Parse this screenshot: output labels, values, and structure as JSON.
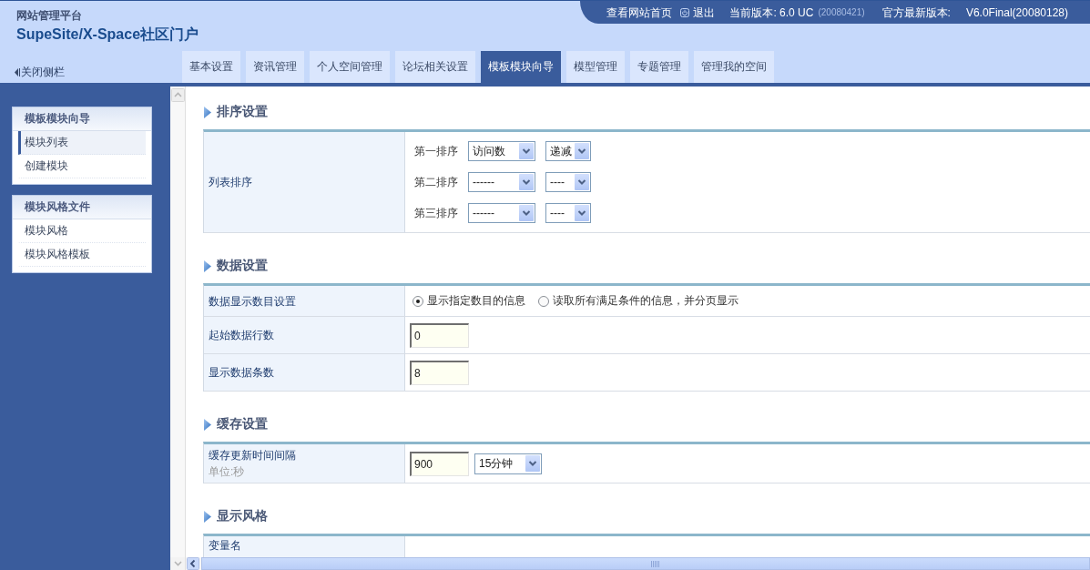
{
  "header": {
    "subtitle": "网站管理平台",
    "title": "SupeSite/X-Space社区门户",
    "toggle_sidebar": "关闭侧栏"
  },
  "top_bar": {
    "home_link": "查看网站首页",
    "logout": "退出",
    "current_version": "当前版本: 6.0 UC",
    "current_build": "(20080421)",
    "latest_label": "官方最新版本:",
    "latest_version": "V6.0Final(20080128)"
  },
  "tabs": [
    {
      "label": "基本设置",
      "selected": false
    },
    {
      "label": "资讯管理",
      "selected": false
    },
    {
      "label": "个人空间管理",
      "selected": false
    },
    {
      "label": "论坛相关设置",
      "selected": false
    },
    {
      "label": "模板模块向导",
      "selected": true
    },
    {
      "label": "模型管理",
      "selected": false
    },
    {
      "label": "专题管理",
      "selected": false
    },
    {
      "label": "管理我的空间",
      "selected": false
    }
  ],
  "sidebar": {
    "groups": [
      {
        "title": "模板模块向导",
        "items": [
          {
            "label": "模块列表",
            "selected": true
          },
          {
            "label": "创建模块",
            "selected": false
          }
        ]
      },
      {
        "title": "模块风格文件",
        "items": [
          {
            "label": "模块风格",
            "selected": false
          },
          {
            "label": "模块风格模板",
            "selected": false
          }
        ]
      }
    ]
  },
  "sections": [
    {
      "title": "排序设置",
      "rows": [
        {
          "kind": "sort",
          "label": "列表排序",
          "sorts": [
            {
              "label": "第一排序",
              "field": "访问数",
              "order": "递减"
            },
            {
              "label": "第二排序",
              "field": "------",
              "order": "----"
            },
            {
              "label": "第三排序",
              "field": "------",
              "order": "----"
            }
          ]
        }
      ]
    },
    {
      "title": "数据设置",
      "rows": [
        {
          "kind": "radio",
          "label": "数据显示数目设置",
          "options": [
            {
              "label": "显示指定数目的信息",
              "selected": true
            },
            {
              "label": "读取所有满足条件的信息，并分页显示",
              "selected": false
            }
          ]
        },
        {
          "kind": "input",
          "label": "起始数据行数",
          "value": "0"
        },
        {
          "kind": "input",
          "label": "显示数据条数",
          "value": "8"
        }
      ]
    },
    {
      "title": "缓存设置",
      "rows": [
        {
          "kind": "input_select",
          "label": "缓存更新时间间隔",
          "hint": "单位:秒",
          "value": "900",
          "select": "15分钟"
        }
      ]
    },
    {
      "title": "显示风格",
      "rows": [
        {
          "kind": "label_only",
          "label": "变量名"
        }
      ]
    }
  ]
}
